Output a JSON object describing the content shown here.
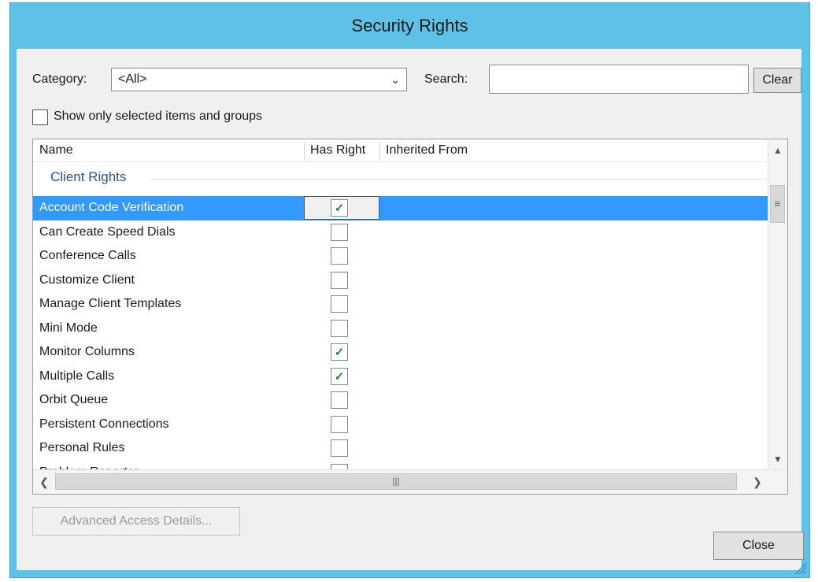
{
  "window": {
    "title": "Security Rights"
  },
  "filter": {
    "category_label": "Category:",
    "category_value": "<All>",
    "search_label": "Search:",
    "search_value": "",
    "clear_label": "Clear",
    "show_selected_label": "Show only selected items and groups"
  },
  "grid": {
    "columns": [
      "Name",
      "Has Right",
      "Inherited From"
    ],
    "group": "Client Rights",
    "rows": [
      {
        "name": "Account Code Verification",
        "checked": true,
        "selected": true
      },
      {
        "name": "Can Create Speed Dials",
        "checked": false
      },
      {
        "name": "Conference Calls",
        "checked": false
      },
      {
        "name": "Customize Client",
        "checked": false
      },
      {
        "name": "Manage Client Templates",
        "checked": false
      },
      {
        "name": "Mini Mode",
        "checked": false
      },
      {
        "name": "Monitor Columns",
        "checked": true
      },
      {
        "name": "Multiple Calls",
        "checked": true
      },
      {
        "name": "Orbit Queue",
        "checked": false
      },
      {
        "name": "Persistent Connections",
        "checked": false
      },
      {
        "name": "Personal Rules",
        "checked": false
      },
      {
        "name": "Problem Reporter",
        "checked": false
      }
    ]
  },
  "buttons": {
    "advanced_label": "Advanced Access Details...",
    "close_label": "Close"
  },
  "colors": {
    "titlebar": "#5fc1e6",
    "selection": "#3399ff",
    "group_header": "#2b4f9c",
    "check": "#2e8b2e"
  },
  "icons": {
    "dropdown": "chevron-down-icon",
    "check": "check-icon"
  }
}
